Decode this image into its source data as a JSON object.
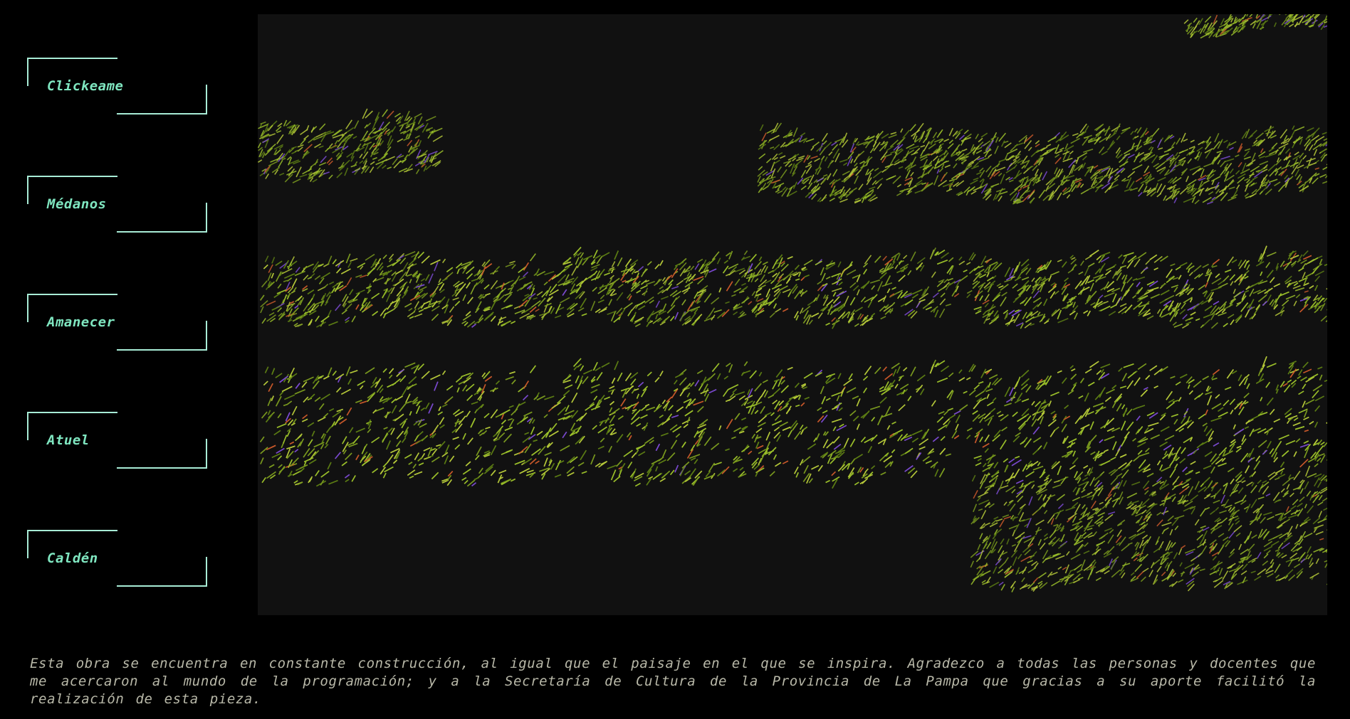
{
  "sidebar": {
    "items": [
      {
        "label": "Clickeame"
      },
      {
        "label": "Médanos"
      },
      {
        "label": "Amanecer"
      },
      {
        "label": "Atuel"
      },
      {
        "label": "Caldén"
      }
    ]
  },
  "canvas": {
    "background": "#111111",
    "palette": [
      "#7a9a1e",
      "#9bbf2a",
      "#5c7d14",
      "#b6c93a",
      "#c8582a",
      "#7a4ad0",
      "#3f5a10"
    ]
  },
  "colors": {
    "accent": "#7fe6c0",
    "bracket": "#a8ecd6",
    "footer_text": "#b8b8a8"
  },
  "footer": {
    "text": "Esta obra se encuentra en constante construcción, al igual que el paisaje en el que se inspira. Agradezco a todas las personas y docentes que me acercaron al mundo de la programación; y a la Secretaría de Cultura de la Provincia de La Pampa que gracias a su aporte facilitó la realización de esta pieza."
  }
}
